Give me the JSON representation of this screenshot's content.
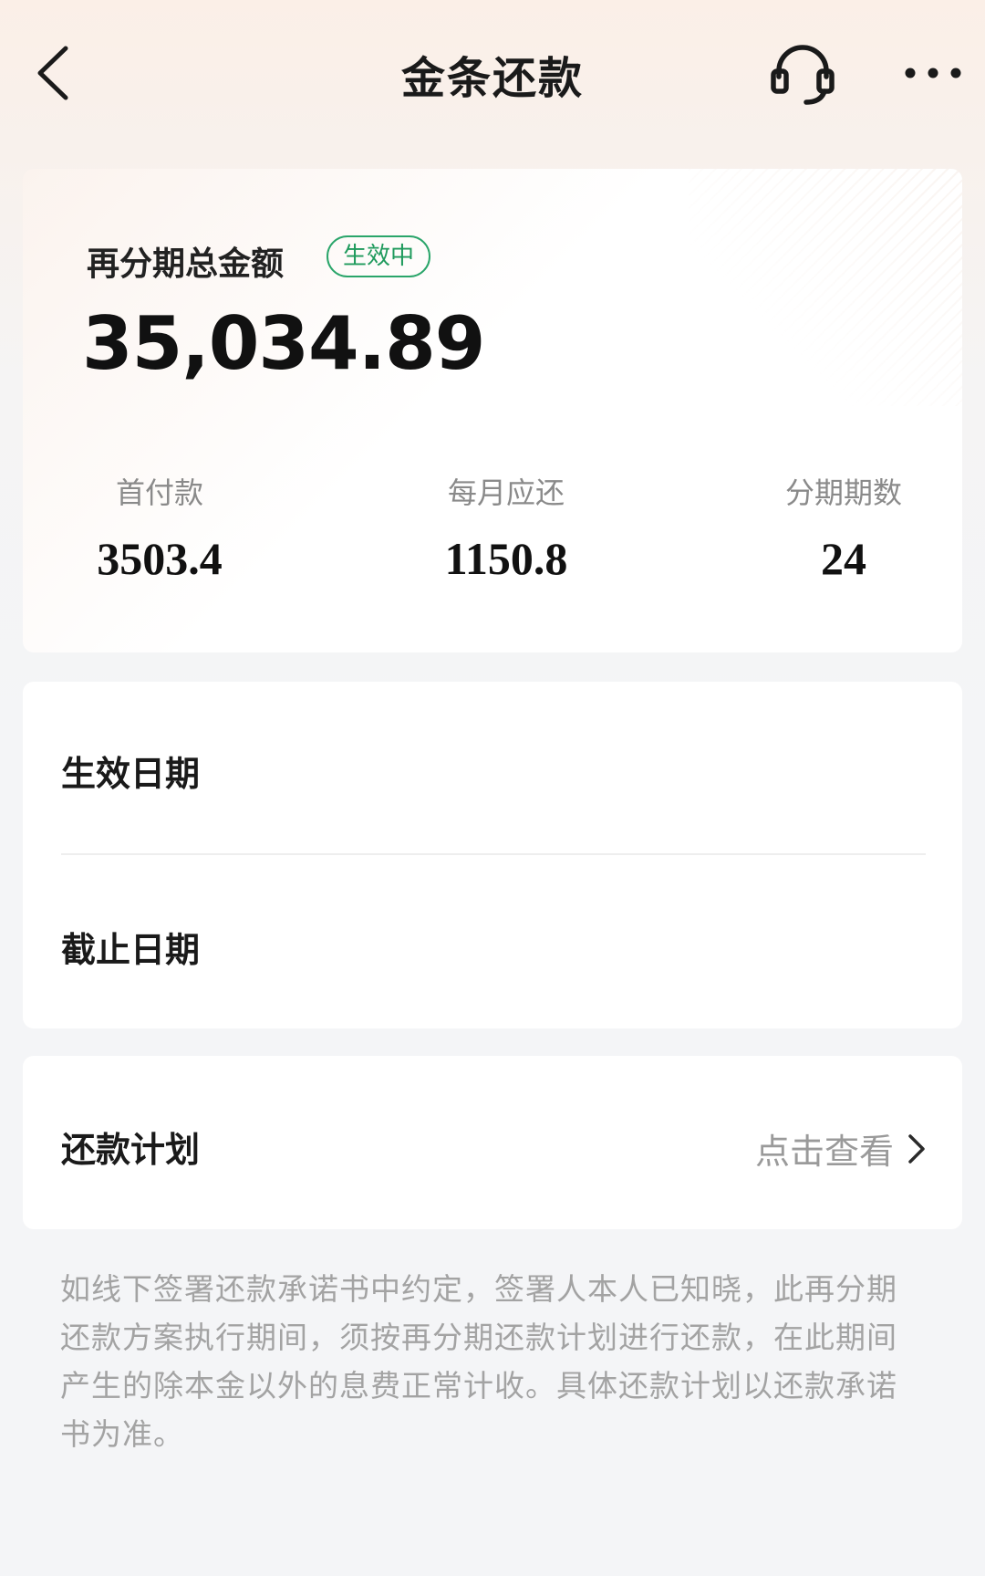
{
  "header": {
    "title": "金条还款",
    "back_icon": "chevron-left-icon",
    "service_icon": "headset-icon",
    "more_icon": "more-dots-icon"
  },
  "summary": {
    "label": "再分期总金额",
    "status": "生效中",
    "status_color": "#1f9a5c",
    "amount": "35,034.89",
    "stats": [
      {
        "label": "首付款",
        "value": "3503.4"
      },
      {
        "label": "每月应还",
        "value": "1150.8"
      },
      {
        "label": "分期期数",
        "value": "24"
      }
    ]
  },
  "dates": {
    "effective_label": "生效日期",
    "deadline_label": "截止日期"
  },
  "plan": {
    "label": "还款计划",
    "link": "点击查看"
  },
  "notice": "如线下签署还款承诺书中约定，签署人本人已知晓，此再分期还款方案执行期间，须按再分期还款计划进行还款，在此期间产生的除本金以外的息费正常计收。具体还款计划以还款承诺书为准。"
}
